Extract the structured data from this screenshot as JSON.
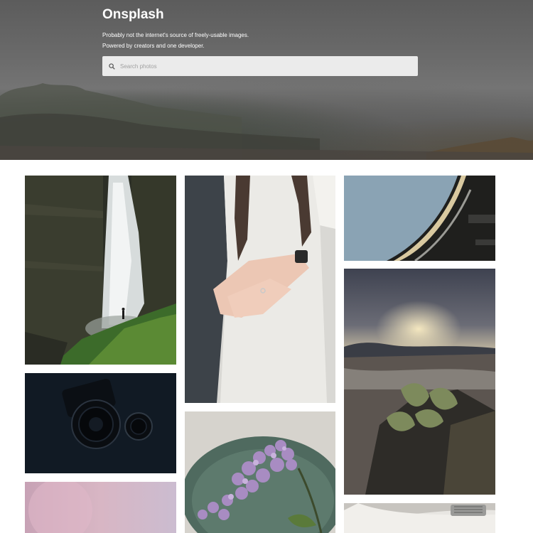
{
  "header": {
    "brand": "Onsplash",
    "tagline_line1": "Probably not the internet's source of freely-usable images.",
    "tagline_line2": "Powered by creators and one developer."
  },
  "search": {
    "placeholder": "Search photos",
    "value": ""
  },
  "icons": {
    "search": "search-icon"
  },
  "colors": {
    "hero_background": "#6a6a6a",
    "search_background": "#ebebeb",
    "page_background": "#ffffff"
  },
  "photos": [
    {
      "subject": "waterfall"
    },
    {
      "subject": "holding-hands"
    },
    {
      "subject": "building-curve"
    },
    {
      "subject": "camera-lens"
    },
    {
      "subject": "lilac-bowl"
    },
    {
      "subject": "sunset-landscape"
    },
    {
      "subject": "pink-blur"
    },
    {
      "subject": "car-detail"
    }
  ]
}
